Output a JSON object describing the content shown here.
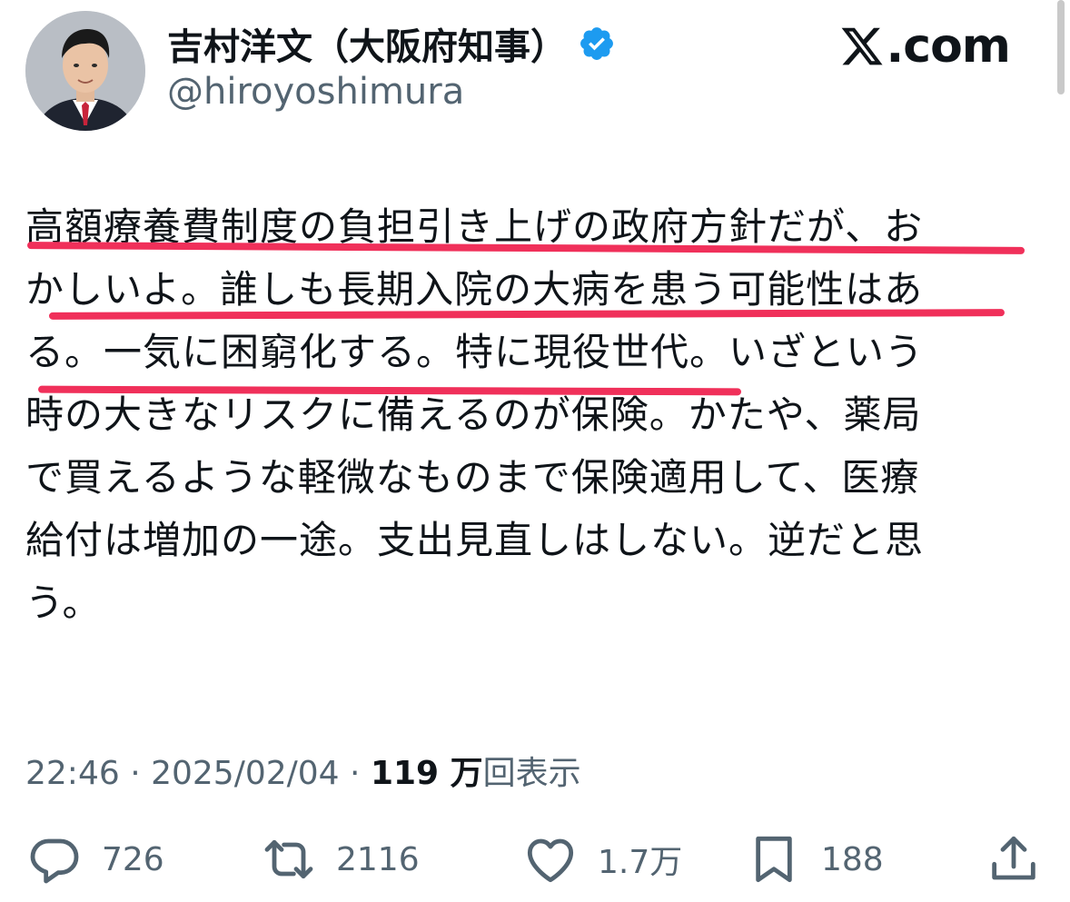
{
  "header": {
    "display_name": "吉村洋文（大阪府知事）",
    "handle": "@hiroyoshimura",
    "site": "𝕏.com",
    "site_text": ".com"
  },
  "tweet": {
    "lines": [
      "高額療養費制度の負担引き上げの政府方針だが、お",
      "かしいよ。誰しも長期入院の大病を患う可能性はあ",
      "る。一気に困窮化する。特に現役世代。いざという",
      "時の大きなリスクに備えるのが保険。かたや、薬局",
      "で買えるような軽微なものまで保険適用して、医療",
      "給付は増加の一途。支出見直しはしない。逆だと思",
      "う。"
    ]
  },
  "meta": {
    "time": "22:46",
    "date": "2025/02/04",
    "separator": " · ",
    "views_count": "119 万",
    "views_label": "回表示"
  },
  "actions": {
    "reply_count": "726",
    "repost_count": "2116",
    "like_count": "1.7万",
    "bookmark_count": "188"
  },
  "colors": {
    "text": "#0f1419",
    "secondary": "#536471",
    "verified_blue": "#1d9bf0",
    "highlight_underline": "#f0305a"
  },
  "icons": [
    "verified-badge-icon",
    "x-logo-icon",
    "reply-icon",
    "repost-icon",
    "like-icon",
    "bookmark-icon",
    "share-icon"
  ]
}
